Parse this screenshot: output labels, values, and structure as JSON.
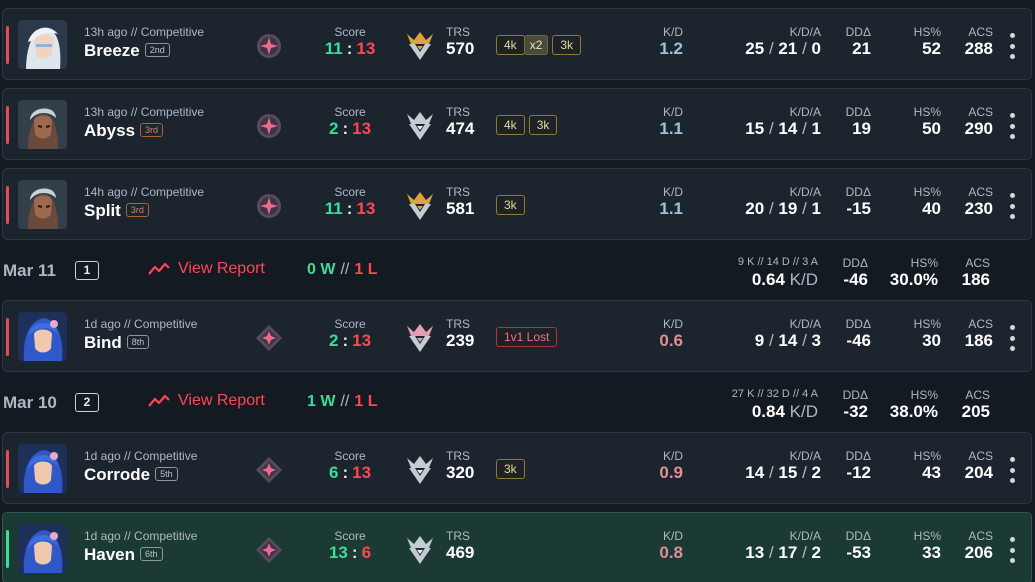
{
  "colors": {
    "win": "#3ddc97",
    "loss": "#ff4655",
    "panel": "#1c242e",
    "win_panel": "#1b3a33"
  },
  "labels": {
    "score": "Score",
    "trs": "TRS",
    "kd": "K/D",
    "kda": "K/D/A",
    "dd": "DDΔ",
    "hs": "HS%",
    "acs": "ACS",
    "score_sep": ":",
    "kda_sep": "/",
    "wl_sep": "//"
  },
  "matches": [
    {
      "meta": "13h ago // Competitive",
      "map": "Breeze",
      "placement": "2nd",
      "score_a": "11",
      "score_b": "13",
      "trs": "570",
      "kd": "1.2",
      "k": "25",
      "d": "21",
      "a": "0",
      "dd": "21",
      "hs": "52",
      "acs": "288",
      "badges": [
        "4k",
        "x2",
        "3k"
      ]
    },
    {
      "meta": "13h ago // Competitive",
      "map": "Abyss",
      "placement": "3rd",
      "score_a": "2",
      "score_b": "13",
      "trs": "474",
      "kd": "1.1",
      "k": "15",
      "d": "14",
      "a": "1",
      "dd": "19",
      "hs": "50",
      "acs": "290",
      "badges": [
        "4k",
        "3k"
      ]
    },
    {
      "meta": "14h ago // Competitive",
      "map": "Split",
      "placement": "3rd",
      "score_a": "11",
      "score_b": "13",
      "trs": "581",
      "kd": "1.1",
      "k": "20",
      "d": "19",
      "a": "1",
      "dd": "-15",
      "hs": "40",
      "acs": "230",
      "badges": [
        "3k"
      ]
    },
    {
      "meta": "1d ago // Competitive",
      "map": "Bind",
      "placement": "8th",
      "score_a": "2",
      "score_b": "13",
      "trs": "239",
      "kd": "0.6",
      "k": "9",
      "d": "14",
      "a": "3",
      "dd": "-46",
      "hs": "30",
      "acs": "186",
      "badges": [
        "1v1 Lost"
      ]
    },
    {
      "meta": "1d ago // Competitive",
      "map": "Corrode",
      "placement": "5th",
      "score_a": "6",
      "score_b": "13",
      "trs": "320",
      "kd": "0.9",
      "k": "14",
      "d": "15",
      "a": "2",
      "dd": "-12",
      "hs": "43",
      "acs": "204",
      "badges": [
        "3k"
      ]
    },
    {
      "meta": "1d ago // Competitive",
      "map": "Haven",
      "placement": "6th",
      "score_a": "13",
      "score_b": "6",
      "trs": "469",
      "kd": "0.8",
      "k": "13",
      "d": "17",
      "a": "2",
      "dd": "-53",
      "hs": "33",
      "acs": "206",
      "badges": []
    }
  ],
  "days": [
    {
      "date": "Mar 11",
      "count": "1",
      "report": "View Report",
      "wins": "0 W",
      "losses": "1 L",
      "kda_summary": "9 K // 14 D // 3 A",
      "kd": "0.64",
      "kd_unit": "K/D",
      "dd": "-46",
      "hs": "30.0%",
      "acs": "186"
    },
    {
      "date": "Mar 10",
      "count": "2",
      "report": "View Report",
      "wins": "1 W",
      "losses": "1 L",
      "kda_summary": "27 K // 32 D // 4 A",
      "kd": "0.84",
      "kd_unit": "K/D",
      "dd": "-32",
      "hs": "38.0%",
      "acs": "205"
    }
  ]
}
